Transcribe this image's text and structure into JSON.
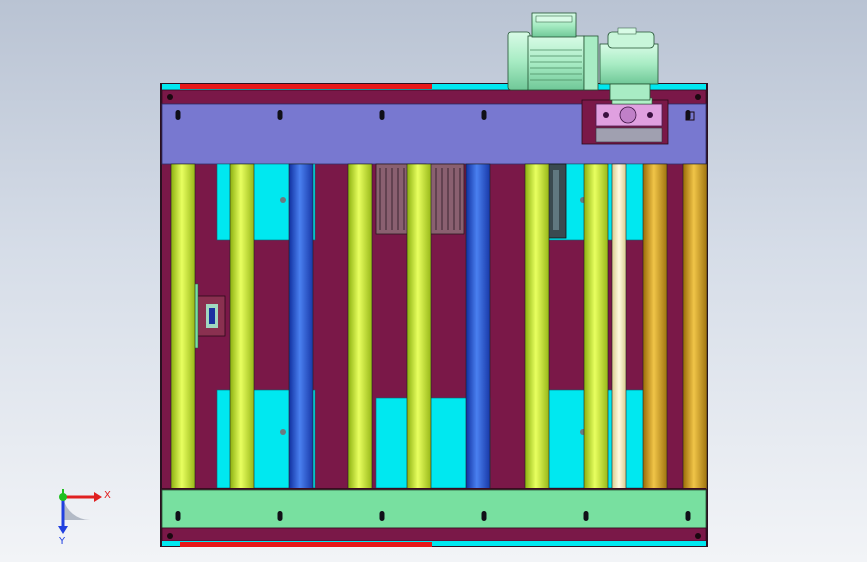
{
  "viewport": {
    "background_top": "#b9c3d3",
    "background_bottom": "#f2f4f7"
  },
  "triad": {
    "x_label": "X",
    "y_label": "Y",
    "x_color": "#e02020",
    "y_color": "#2040e0",
    "origin_color": "#20c020"
  },
  "colors": {
    "frame": "#7a1848",
    "frame_dark": "#5a1035",
    "top_plate": "#7878d0",
    "bottom_plate": "#78e0a0",
    "cyan": "#00e8f0",
    "red_rail": "#e81818",
    "roller_lime": "#c8f020",
    "roller_blue": "#2050d0",
    "roller_gold": "#d0a020",
    "roller_cream": "#f8f0c0",
    "motor_green": "#b0f0c8",
    "gear_pink": "#e0a0e0"
  },
  "rollers": [
    {
      "type": "lime"
    },
    {
      "type": "lime"
    },
    {
      "type": "blue"
    },
    {
      "type": "lime"
    },
    {
      "type": "lime"
    },
    {
      "type": "blue"
    },
    {
      "type": "lime"
    },
    {
      "type": "lime"
    },
    {
      "type": "cream"
    },
    {
      "type": "gold"
    },
    {
      "type": "gold"
    }
  ]
}
